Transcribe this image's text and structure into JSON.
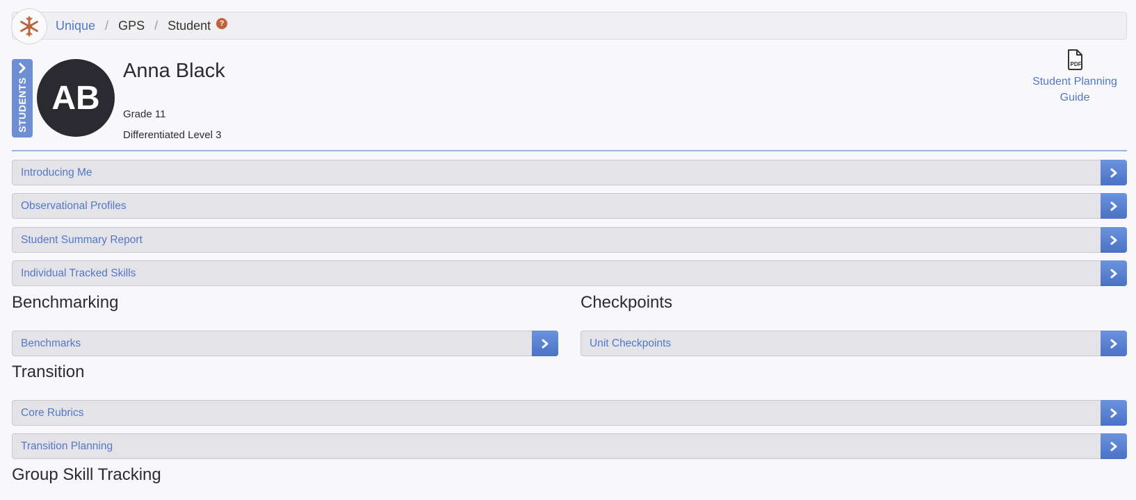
{
  "breadcrumb": {
    "items": [
      {
        "label": "Unique",
        "link": true
      },
      {
        "label": "GPS",
        "link": false
      },
      {
        "label": "Student",
        "link": false
      }
    ],
    "separator": "/",
    "help": "?"
  },
  "sidebar_tab": {
    "label": "STUDENTS"
  },
  "student": {
    "initials": "AB",
    "name": "Anna Black",
    "grade": "Grade 11",
    "level": "Differentiated Level 3"
  },
  "guide": {
    "line1": "Student Planning",
    "line2": "Guide",
    "icon_text": "PDF"
  },
  "rows": {
    "introducing_me": "Introducing Me",
    "observational_profiles": "Observational Profiles",
    "student_summary_report": "Student Summary Report",
    "individual_tracked_skills": "Individual Tracked Skills",
    "benchmarks": "Benchmarks",
    "unit_checkpoints": "Unit Checkpoints",
    "core_rubrics": "Core Rubrics",
    "transition_planning": "Transition Planning"
  },
  "sections": {
    "benchmarking": "Benchmarking",
    "checkpoints": "Checkpoints",
    "transition": "Transition",
    "group_skill_tracking": "Group Skill Tracking"
  },
  "colors": {
    "accent": "#5277c9",
    "button": "#5a82d3",
    "avatar": "#2a2a30",
    "help": "#c0623a"
  }
}
